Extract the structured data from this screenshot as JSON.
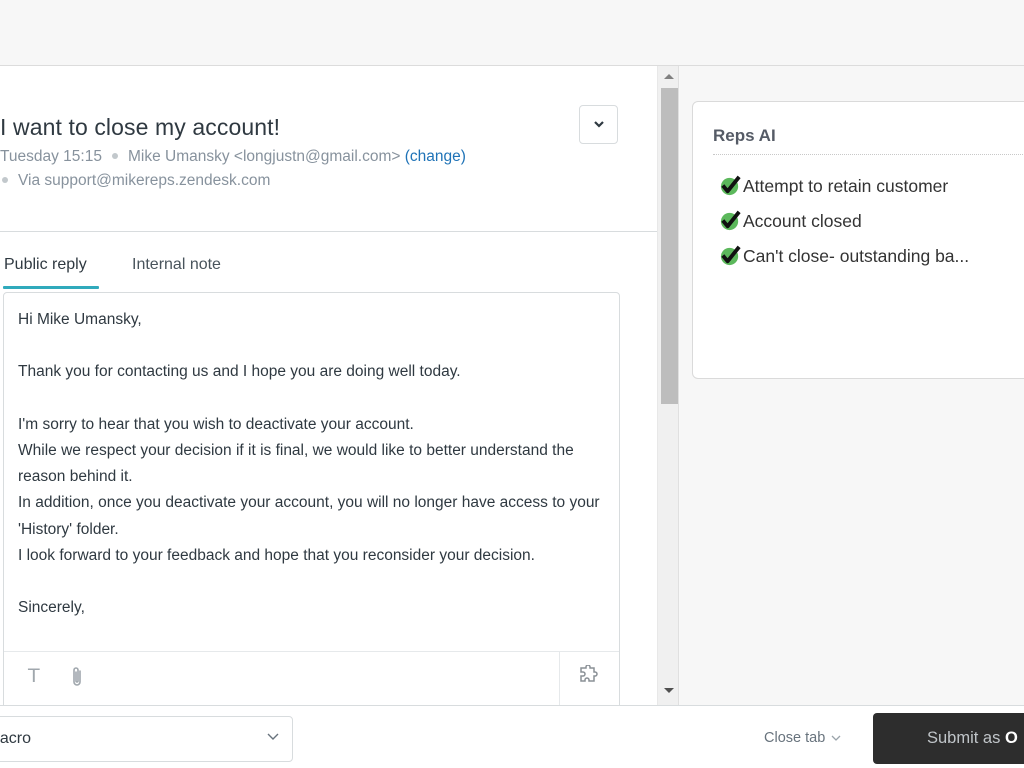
{
  "ticket": {
    "title": "I want to close my account!",
    "timestamp": "Tuesday 15:15",
    "requester": "Mike Umansky <longjustn@gmail.com>",
    "change_link": "(change)",
    "via": "Via support@mikereps.zendesk.com"
  },
  "composer": {
    "tabs": [
      {
        "label": "Public reply",
        "active": true
      },
      {
        "label": "Internal note",
        "active": false
      }
    ],
    "body": "Hi Mike Umansky,\n\nThank you for contacting us and I hope you are doing well today.\n\nI'm sorry to hear that you wish to deactivate your account.\nWhile we respect your decision if it is final, we would like to better understand the reason behind it.\nIn addition, once you deactivate your account, you will no longer have access to your 'History' folder.\nI look forward to your feedback and hope that you reconsider your decision.\n\nSincerely,",
    "toolbar": {
      "text_format_glyph": "T"
    }
  },
  "app_panel": {
    "title": "Reps AI",
    "items": [
      {
        "label": "Attempt to retain customer",
        "status": "checked"
      },
      {
        "label": "Account closed",
        "status": "checked"
      },
      {
        "label": "Can't close- outstanding ba...",
        "status": "checked"
      }
    ],
    "check_color": "#5cb85c"
  },
  "footer": {
    "macro_label": "nacro",
    "close_tab_label": "Close tab",
    "submit_prefix": "Submit as ",
    "submit_status": "O"
  },
  "colors": {
    "accent_tab": "#30aabc",
    "link": "#1f73b7",
    "submit_bg": "#2d2d2d"
  }
}
